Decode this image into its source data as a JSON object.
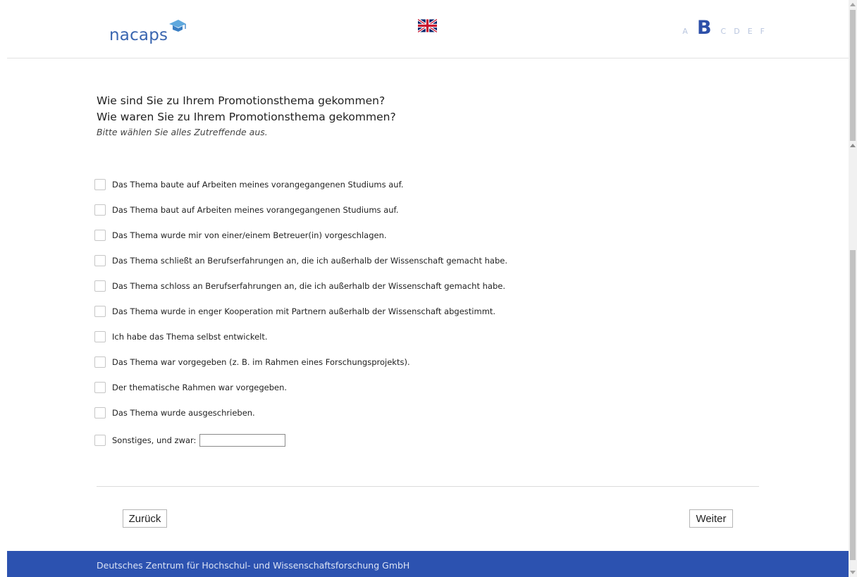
{
  "header": {
    "logo_text": "nacaps",
    "language_flag": "uk-flag-icon",
    "steps": [
      {
        "label": "A",
        "active": false
      },
      {
        "label": "B",
        "active": true
      },
      {
        "label": "C",
        "active": false
      },
      {
        "label": "D",
        "active": false
      },
      {
        "label": "E",
        "active": false
      },
      {
        "label": "F",
        "active": false
      }
    ]
  },
  "question": {
    "title_line1": "Wie sind Sie zu Ihrem Promotionsthema gekommen?",
    "title_line2": "Wie waren Sie zu Ihrem Promotionsthema gekommen?",
    "hint": "Bitte wählen Sie alles Zutreffende aus."
  },
  "options": [
    "Das Thema baute auf Arbeiten meines vorangegangenen Studiums auf.",
    "Das Thema baut auf Arbeiten meines vorangegangenen Studiums auf.",
    "Das Thema wurde mir von einer/einem Betreuer(in) vorgeschlagen.",
    "Das Thema schließt an Berufserfahrungen an, die ich außerhalb der Wissenschaft gemacht habe.",
    "Das Thema schloss an Berufserfahrungen an, die ich außerhalb der Wissenschaft gemacht habe.",
    "Das Thema wurde in enger Kooperation mit Partnern außerhalb der Wissenschaft abgestimmt.",
    "Ich habe das Thema selbst entwickelt.",
    "Das Thema war vorgegeben (z. B. im Rahmen eines Forschungsprojekts).",
    "Der thematische Rahmen war vorgegeben.",
    "Das Thema wurde ausgeschrieben."
  ],
  "other_option": {
    "label": "Sonstiges, und zwar:",
    "value": ""
  },
  "buttons": {
    "back": "Zurück",
    "next": "Weiter"
  },
  "footer": {
    "text": "Deutsches Zentrum für Hochschul- und Wissenschaftsforschung GmbH"
  },
  "colors": {
    "brand": "#3a66b0",
    "active_step": "#2c4fa8",
    "inactive_step": "#b9c6df",
    "footer_bg": "#2c52b0"
  }
}
